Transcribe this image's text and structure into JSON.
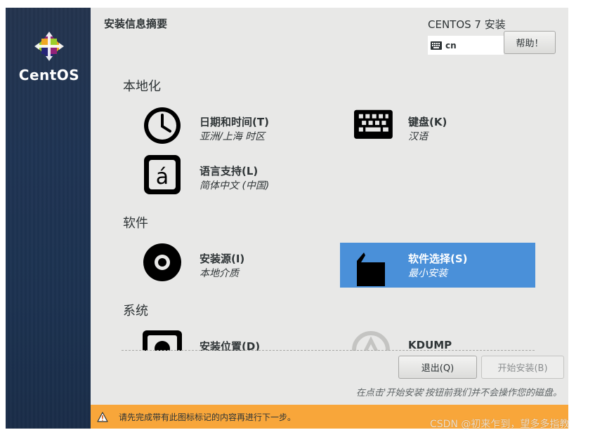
{
  "sidebar": {
    "logo_text": "CentOS"
  },
  "header": {
    "title": "安装信息摘要",
    "product": "CENTOS 7 安装",
    "keyboard_layout": "cn",
    "help_label": "帮助！"
  },
  "sections": {
    "localization": {
      "title": "本地化",
      "datetime": {
        "title": "日期和时间(T)",
        "status": "亚洲/上海 时区",
        "icon": "clock-icon"
      },
      "keyboard": {
        "title": "键盘(K)",
        "status": "汉语",
        "icon": "keyboard-icon"
      },
      "language": {
        "title": "语言支持(L)",
        "status": "简体中文 (中国)",
        "icon": "language-icon"
      }
    },
    "software": {
      "title": "软件",
      "source": {
        "title": "安装源(I)",
        "status": "本地介质",
        "icon": "disc-icon"
      },
      "selection": {
        "title": "软件选择(S)",
        "status": "最小安装",
        "icon": "package-icon"
      }
    },
    "system": {
      "title": "系统",
      "destination": {
        "title": "安装位置(D)",
        "icon": "disk-icon"
      },
      "kdump": {
        "title": "KDUMP",
        "icon": "kdump-icon"
      }
    }
  },
  "footer": {
    "quit_label": "退出(Q)",
    "begin_label": "开始安装(B)",
    "note": "在点击'开始安装'按钮前我们并不会操作您的磁盘。",
    "warning": "请先完成带有此图标标记的内容再进行下一步。"
  },
  "watermark": "CSDN @初来乍到，望多多指教",
  "colors": {
    "sidebar": "#1f3453",
    "main_bg": "#e8e8e7",
    "selected": "#4a90d9",
    "warning_bar": "#f8a63a"
  }
}
